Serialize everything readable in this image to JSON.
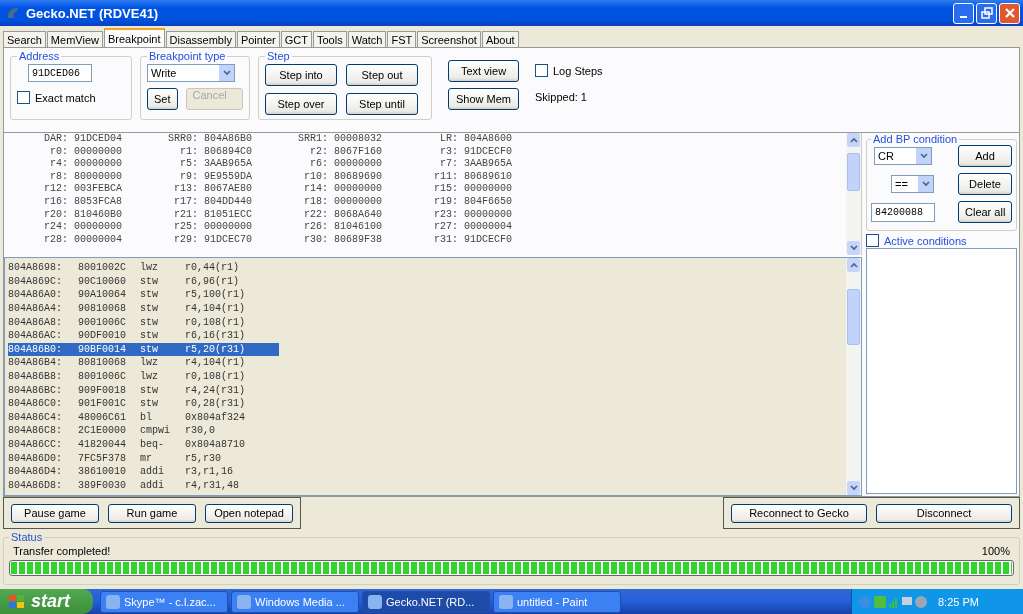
{
  "window": {
    "title": "Gecko.NET (RDVE41)"
  },
  "tabs": [
    {
      "label": "Search",
      "selected": false
    },
    {
      "label": "MemView",
      "selected": false
    },
    {
      "label": "Breakpoint",
      "selected": true
    },
    {
      "label": "Disassembly",
      "selected": false
    },
    {
      "label": "Pointer",
      "selected": false
    },
    {
      "label": "GCT",
      "selected": false
    },
    {
      "label": "Tools",
      "selected": false
    },
    {
      "label": "Watch",
      "selected": false
    },
    {
      "label": "FST",
      "selected": false
    },
    {
      "label": "Screenshot",
      "selected": false
    },
    {
      "label": "About",
      "selected": false
    }
  ],
  "address": {
    "label": "Address",
    "value": "91DCED06",
    "exact_match": {
      "label": "Exact match",
      "checked": false
    }
  },
  "breakpoint_type": {
    "label": "Breakpoint type",
    "value": "Write",
    "set": {
      "label": "Set",
      "disabled": false
    },
    "cancel": {
      "label": "Cancel",
      "disabled": true
    }
  },
  "step": {
    "label": "Step",
    "buttons": [
      "Step into",
      "Step out",
      "Step over",
      "Step until"
    ]
  },
  "view_buttons": [
    "Text view",
    "Show Mem"
  ],
  "log_steps": {
    "label": "Log Steps",
    "checked": false
  },
  "skipped": "Skipped: 1",
  "registers": [
    [
      {
        "name": "DAR:",
        "value": "91DCED04"
      },
      {
        "name": "SRR0:",
        "value": "804A86B0"
      },
      {
        "name": "SRR1:",
        "value": "00008032"
      },
      {
        "name": "LR:",
        "value": "804A8600"
      }
    ],
    [
      {
        "name": "r0:",
        "value": "00000000"
      },
      {
        "name": "r1:",
        "value": "806894C0"
      },
      {
        "name": "r2:",
        "value": "8067F160"
      },
      {
        "name": "r3:",
        "value": "91DCECF0"
      }
    ],
    [
      {
        "name": "r4:",
        "value": "00000000"
      },
      {
        "name": "r5:",
        "value": "3AAB965A"
      },
      {
        "name": "r6:",
        "value": "00000000"
      },
      {
        "name": "r7:",
        "value": "3AAB965A"
      }
    ],
    [
      {
        "name": "r8:",
        "value": "80000000"
      },
      {
        "name": "r9:",
        "value": "9E9559DA"
      },
      {
        "name": "r10:",
        "value": "80689690"
      },
      {
        "name": "r11:",
        "value": "80689610"
      }
    ],
    [
      {
        "name": "r12:",
        "value": "003FEBCA"
      },
      {
        "name": "r13:",
        "value": "8067AE80"
      },
      {
        "name": "r14:",
        "value": "00000000"
      },
      {
        "name": "r15:",
        "value": "00000000"
      }
    ],
    [
      {
        "name": "r16:",
        "value": "8053FCA8"
      },
      {
        "name": "r17:",
        "value": "804DD440"
      },
      {
        "name": "r18:",
        "value": "00000000"
      },
      {
        "name": "r19:",
        "value": "804F6650"
      }
    ],
    [
      {
        "name": "r20:",
        "value": "810460B0"
      },
      {
        "name": "r21:",
        "value": "81051ECC"
      },
      {
        "name": "r22:",
        "value": "8068A640"
      },
      {
        "name": "r23:",
        "value": "00000000"
      }
    ],
    [
      {
        "name": "r24:",
        "value": "00000000"
      },
      {
        "name": "r25:",
        "value": "00000000"
      },
      {
        "name": "r26:",
        "value": "81046100"
      },
      {
        "name": "r27:",
        "value": "00000004"
      }
    ],
    [
      {
        "name": "r28:",
        "value": "00000004"
      },
      {
        "name": "r29:",
        "value": "91DCEC70"
      },
      {
        "name": "r30:",
        "value": "80689F38"
      },
      {
        "name": "r31:",
        "value": "91DCECF0"
      }
    ]
  ],
  "disassembly": [
    {
      "address": "804A8698:",
      "opcode": "8001002C",
      "mnemonic": "lwz",
      "operands": "r0,44(r1)",
      "selected": false
    },
    {
      "address": "804A869C:",
      "opcode": "90C10060",
      "mnemonic": "stw",
      "operands": "r6,96(r1)",
      "selected": false
    },
    {
      "address": "804A86A0:",
      "opcode": "90A10064",
      "mnemonic": "stw",
      "operands": "r5,100(r1)",
      "selected": false
    },
    {
      "address": "804A86A4:",
      "opcode": "90810068",
      "mnemonic": "stw",
      "operands": "r4,104(r1)",
      "selected": false
    },
    {
      "address": "804A86A8:",
      "opcode": "9001006C",
      "mnemonic": "stw",
      "operands": "r0,108(r1)",
      "selected": false
    },
    {
      "address": "804A86AC:",
      "opcode": "90DF0010",
      "mnemonic": "stw",
      "operands": "r6,16(r31)",
      "selected": false
    },
    {
      "address": "804A86B0:",
      "opcode": "90BF0014",
      "mnemonic": "stw",
      "operands": "r5,20(r31)",
      "selected": true
    },
    {
      "address": "804A86B4:",
      "opcode": "80810068",
      "mnemonic": "lwz",
      "operands": "r4,104(r1)",
      "selected": false
    },
    {
      "address": "804A86B8:",
      "opcode": "8001006C",
      "mnemonic": "lwz",
      "operands": "r0,108(r1)",
      "selected": false
    },
    {
      "address": "804A86BC:",
      "opcode": "909F0018",
      "mnemonic": "stw",
      "operands": "r4,24(r31)",
      "selected": false
    },
    {
      "address": "804A86C0:",
      "opcode": "901F001C",
      "mnemonic": "stw",
      "operands": "r0,28(r31)",
      "selected": false
    },
    {
      "address": "804A86C4:",
      "opcode": "48006C61",
      "mnemonic": "bl",
      "operands": "0x804af324",
      "selected": false
    },
    {
      "address": "804A86C8:",
      "opcode": "2C1E0000",
      "mnemonic": "cmpwi",
      "operands": "r30,0",
      "selected": false
    },
    {
      "address": "804A86CC:",
      "opcode": "41820044",
      "mnemonic": "beq-",
      "operands": "0x804a8710",
      "selected": false
    },
    {
      "address": "804A86D0:",
      "opcode": "7FC5F378",
      "mnemonic": "mr",
      "operands": "r5,r30",
      "selected": false
    },
    {
      "address": "804A86D4:",
      "opcode": "38610010",
      "mnemonic": "addi",
      "operands": "r3,r1,16",
      "selected": false
    },
    {
      "address": "804A86D8:",
      "opcode": "389F0030",
      "mnemonic": "addi",
      "operands": "r4,r31,48",
      "selected": false
    }
  ],
  "bp_condition": {
    "label": "Add BP condition",
    "register": "CR",
    "operator": "==",
    "value": "84200088",
    "buttons": [
      "Add",
      "Delete",
      "Clear all"
    ]
  },
  "active_conditions": {
    "label": "Active conditions",
    "checked": false
  },
  "game_buttons": [
    "Pause game",
    "Run game",
    "Open notepad"
  ],
  "connection_buttons": [
    "Reconnect to Gecko",
    "Disconnect"
  ],
  "status": {
    "label": "Status",
    "message": "Transfer completed!",
    "percent": "100%",
    "level": 1
  },
  "taskbar": {
    "start": "start",
    "items": [
      {
        "label": "Skype™ - c.l.zac...",
        "selected": false
      },
      {
        "label": "Windows Media ...",
        "selected": false
      },
      {
        "label": "Gecko.NET (RD...",
        "selected": true
      },
      {
        "label": "untitled - Paint",
        "selected": false
      }
    ],
    "clock": "8:25 PM"
  }
}
